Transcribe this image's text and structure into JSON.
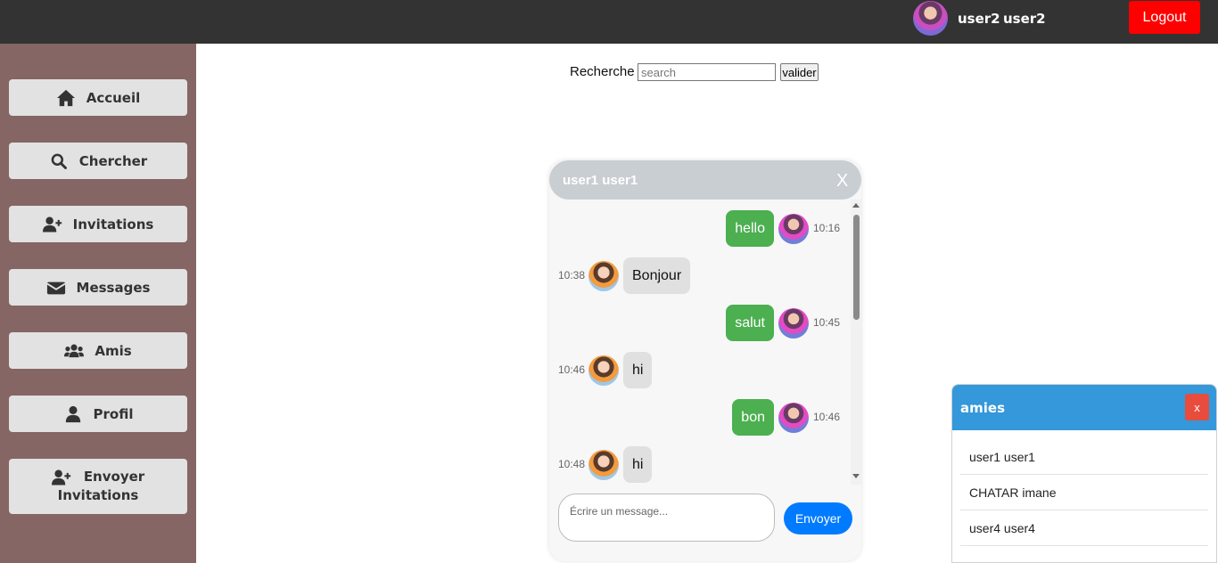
{
  "header": {
    "avatar_icon": "user-avatar",
    "user_first": "user2",
    "user_last": "user2",
    "logout_label": "Logout",
    "logout_color": "#ff0000"
  },
  "sidebar": {
    "background": "#866565",
    "items": [
      {
        "label": "Accueil",
        "icon": "home-icon"
      },
      {
        "label": "Chercher",
        "icon": "search-icon"
      },
      {
        "label": "Invitations",
        "icon": "user-plus-icon"
      },
      {
        "label": "Messages",
        "icon": "envelope-icon"
      },
      {
        "label": "Amis",
        "icon": "users-icon"
      },
      {
        "label": "Profil",
        "icon": "user-icon"
      },
      {
        "label_line1": "Envoyer",
        "label_line2": "Invitations",
        "icon": "user-plus-icon"
      }
    ]
  },
  "search": {
    "label": "Recherche",
    "placeholder": "search",
    "value": "",
    "button_label": "valider"
  },
  "chat": {
    "title": "user1 user1",
    "close_label": "X",
    "messages": [
      {
        "direction": "out",
        "text": "hello",
        "time": "10:16"
      },
      {
        "direction": "in",
        "text": "Bonjour",
        "time": "10:38"
      },
      {
        "direction": "out",
        "text": "salut",
        "time": "10:45"
      },
      {
        "direction": "in",
        "text": "hi",
        "time": "10:46"
      },
      {
        "direction": "out",
        "text": "bon",
        "time": "10:46"
      },
      {
        "direction": "in",
        "text": "hi",
        "time": "10:48"
      }
    ],
    "composer_placeholder": "Écrire un message...",
    "send_label": "Envoyer",
    "out_color": "#4caf50",
    "send_color": "#007bff"
  },
  "friends_panel": {
    "title": "amies",
    "close_label": "x",
    "header_color": "#3498db",
    "friends": [
      "user1 user1",
      "CHATAR imane",
      "user4 user4"
    ]
  }
}
